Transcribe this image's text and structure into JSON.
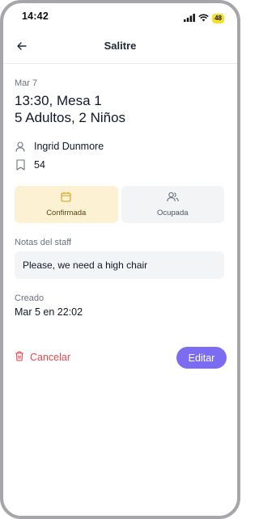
{
  "status_bar": {
    "time": "14:42",
    "battery": "48"
  },
  "header": {
    "title": "Salitre"
  },
  "reservation": {
    "date": "Mar 7",
    "time_table": "13:30, Mesa 1",
    "party": "5 Adultos, 2 Niños",
    "guest_name": "Ingrid Dunmore",
    "visits": "54"
  },
  "status_cards": [
    {
      "label": "Confirmada",
      "icon": "calendar-icon",
      "active": true
    },
    {
      "label": "Ocupada",
      "icon": "users-icon",
      "active": false
    }
  ],
  "notes": {
    "label": "Notas del staff",
    "value": "Please, we need a high chair"
  },
  "created": {
    "label": "Creado",
    "value": "Mar 5 en 22:02"
  },
  "actions": {
    "cancel_label": "Cancelar",
    "edit_label": "Editar"
  },
  "colors": {
    "accent": "#7c6cf2",
    "danger": "#e5484d",
    "confirmed_bg": "#fdf1d4"
  }
}
